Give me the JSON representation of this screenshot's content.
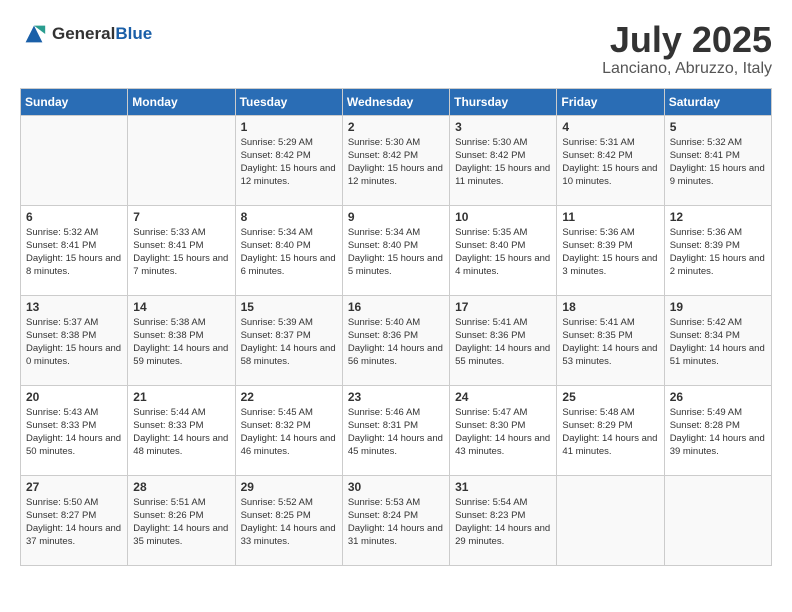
{
  "header": {
    "logo_general": "General",
    "logo_blue": "Blue",
    "month": "July 2025",
    "location": "Lanciano, Abruzzo, Italy"
  },
  "weekdays": [
    "Sunday",
    "Monday",
    "Tuesday",
    "Wednesday",
    "Thursday",
    "Friday",
    "Saturday"
  ],
  "weeks": [
    [
      {
        "day": "",
        "sunrise": "",
        "sunset": "",
        "daylight": ""
      },
      {
        "day": "",
        "sunrise": "",
        "sunset": "",
        "daylight": ""
      },
      {
        "day": "1",
        "sunrise": "Sunrise: 5:29 AM",
        "sunset": "Sunset: 8:42 PM",
        "daylight": "Daylight: 15 hours and 12 minutes."
      },
      {
        "day": "2",
        "sunrise": "Sunrise: 5:30 AM",
        "sunset": "Sunset: 8:42 PM",
        "daylight": "Daylight: 15 hours and 12 minutes."
      },
      {
        "day": "3",
        "sunrise": "Sunrise: 5:30 AM",
        "sunset": "Sunset: 8:42 PM",
        "daylight": "Daylight: 15 hours and 11 minutes."
      },
      {
        "day": "4",
        "sunrise": "Sunrise: 5:31 AM",
        "sunset": "Sunset: 8:42 PM",
        "daylight": "Daylight: 15 hours and 10 minutes."
      },
      {
        "day": "5",
        "sunrise": "Sunrise: 5:32 AM",
        "sunset": "Sunset: 8:41 PM",
        "daylight": "Daylight: 15 hours and 9 minutes."
      }
    ],
    [
      {
        "day": "6",
        "sunrise": "Sunrise: 5:32 AM",
        "sunset": "Sunset: 8:41 PM",
        "daylight": "Daylight: 15 hours and 8 minutes."
      },
      {
        "day": "7",
        "sunrise": "Sunrise: 5:33 AM",
        "sunset": "Sunset: 8:41 PM",
        "daylight": "Daylight: 15 hours and 7 minutes."
      },
      {
        "day": "8",
        "sunrise": "Sunrise: 5:34 AM",
        "sunset": "Sunset: 8:40 PM",
        "daylight": "Daylight: 15 hours and 6 minutes."
      },
      {
        "day": "9",
        "sunrise": "Sunrise: 5:34 AM",
        "sunset": "Sunset: 8:40 PM",
        "daylight": "Daylight: 15 hours and 5 minutes."
      },
      {
        "day": "10",
        "sunrise": "Sunrise: 5:35 AM",
        "sunset": "Sunset: 8:40 PM",
        "daylight": "Daylight: 15 hours and 4 minutes."
      },
      {
        "day": "11",
        "sunrise": "Sunrise: 5:36 AM",
        "sunset": "Sunset: 8:39 PM",
        "daylight": "Daylight: 15 hours and 3 minutes."
      },
      {
        "day": "12",
        "sunrise": "Sunrise: 5:36 AM",
        "sunset": "Sunset: 8:39 PM",
        "daylight": "Daylight: 15 hours and 2 minutes."
      }
    ],
    [
      {
        "day": "13",
        "sunrise": "Sunrise: 5:37 AM",
        "sunset": "Sunset: 8:38 PM",
        "daylight": "Daylight: 15 hours and 0 minutes."
      },
      {
        "day": "14",
        "sunrise": "Sunrise: 5:38 AM",
        "sunset": "Sunset: 8:38 PM",
        "daylight": "Daylight: 14 hours and 59 minutes."
      },
      {
        "day": "15",
        "sunrise": "Sunrise: 5:39 AM",
        "sunset": "Sunset: 8:37 PM",
        "daylight": "Daylight: 14 hours and 58 minutes."
      },
      {
        "day": "16",
        "sunrise": "Sunrise: 5:40 AM",
        "sunset": "Sunset: 8:36 PM",
        "daylight": "Daylight: 14 hours and 56 minutes."
      },
      {
        "day": "17",
        "sunrise": "Sunrise: 5:41 AM",
        "sunset": "Sunset: 8:36 PM",
        "daylight": "Daylight: 14 hours and 55 minutes."
      },
      {
        "day": "18",
        "sunrise": "Sunrise: 5:41 AM",
        "sunset": "Sunset: 8:35 PM",
        "daylight": "Daylight: 14 hours and 53 minutes."
      },
      {
        "day": "19",
        "sunrise": "Sunrise: 5:42 AM",
        "sunset": "Sunset: 8:34 PM",
        "daylight": "Daylight: 14 hours and 51 minutes."
      }
    ],
    [
      {
        "day": "20",
        "sunrise": "Sunrise: 5:43 AM",
        "sunset": "Sunset: 8:33 PM",
        "daylight": "Daylight: 14 hours and 50 minutes."
      },
      {
        "day": "21",
        "sunrise": "Sunrise: 5:44 AM",
        "sunset": "Sunset: 8:33 PM",
        "daylight": "Daylight: 14 hours and 48 minutes."
      },
      {
        "day": "22",
        "sunrise": "Sunrise: 5:45 AM",
        "sunset": "Sunset: 8:32 PM",
        "daylight": "Daylight: 14 hours and 46 minutes."
      },
      {
        "day": "23",
        "sunrise": "Sunrise: 5:46 AM",
        "sunset": "Sunset: 8:31 PM",
        "daylight": "Daylight: 14 hours and 45 minutes."
      },
      {
        "day": "24",
        "sunrise": "Sunrise: 5:47 AM",
        "sunset": "Sunset: 8:30 PM",
        "daylight": "Daylight: 14 hours and 43 minutes."
      },
      {
        "day": "25",
        "sunrise": "Sunrise: 5:48 AM",
        "sunset": "Sunset: 8:29 PM",
        "daylight": "Daylight: 14 hours and 41 minutes."
      },
      {
        "day": "26",
        "sunrise": "Sunrise: 5:49 AM",
        "sunset": "Sunset: 8:28 PM",
        "daylight": "Daylight: 14 hours and 39 minutes."
      }
    ],
    [
      {
        "day": "27",
        "sunrise": "Sunrise: 5:50 AM",
        "sunset": "Sunset: 8:27 PM",
        "daylight": "Daylight: 14 hours and 37 minutes."
      },
      {
        "day": "28",
        "sunrise": "Sunrise: 5:51 AM",
        "sunset": "Sunset: 8:26 PM",
        "daylight": "Daylight: 14 hours and 35 minutes."
      },
      {
        "day": "29",
        "sunrise": "Sunrise: 5:52 AM",
        "sunset": "Sunset: 8:25 PM",
        "daylight": "Daylight: 14 hours and 33 minutes."
      },
      {
        "day": "30",
        "sunrise": "Sunrise: 5:53 AM",
        "sunset": "Sunset: 8:24 PM",
        "daylight": "Daylight: 14 hours and 31 minutes."
      },
      {
        "day": "31",
        "sunrise": "Sunrise: 5:54 AM",
        "sunset": "Sunset: 8:23 PM",
        "daylight": "Daylight: 14 hours and 29 minutes."
      },
      {
        "day": "",
        "sunrise": "",
        "sunset": "",
        "daylight": ""
      },
      {
        "day": "",
        "sunrise": "",
        "sunset": "",
        "daylight": ""
      }
    ]
  ]
}
